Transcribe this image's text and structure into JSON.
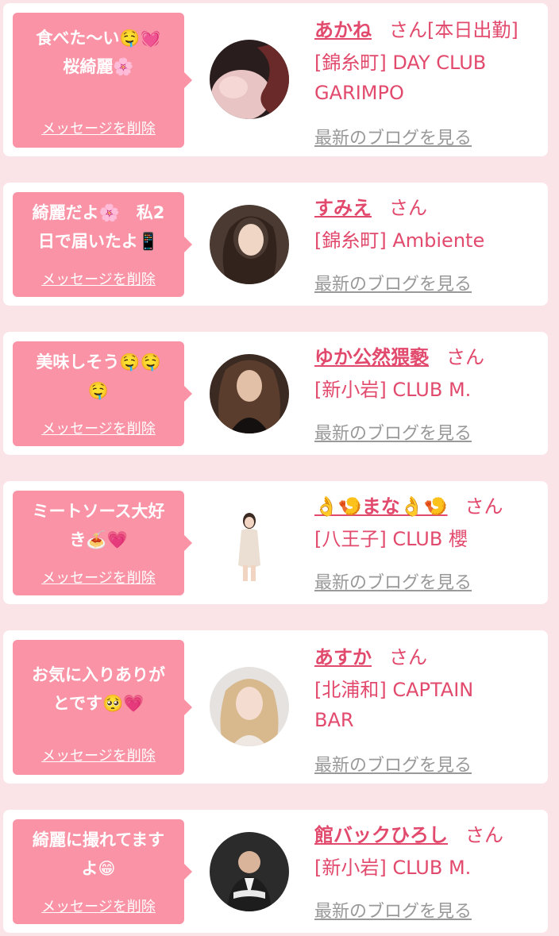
{
  "colors": {
    "page_bg": "#fbe4e8",
    "bubble": "#f993a5",
    "accent": "#e24a6d",
    "link_gray": "#999999"
  },
  "delete_label": "メッセージを削除",
  "blog_label": "最新のブログを見る",
  "suffix": "さん",
  "cards": [
    {
      "message_lines": [
        "食べた〜い🤤💓",
        "桜綺麗🌸"
      ],
      "name": "あかね",
      "status": "[本日出勤]",
      "shop_lines": [
        "[錦糸町] DAY CLUB",
        "GARIMPO"
      ]
    },
    {
      "message_lines": [
        "綺麗だよ🌸　私2",
        "日で届いたよ📱"
      ],
      "name": "すみえ",
      "status": "",
      "shop_lines": [
        "[錦糸町] Ambiente"
      ]
    },
    {
      "message_lines": [
        "美味しそう🤤🤤",
        "🤤"
      ],
      "name": "ゆか公然猥褻",
      "status": "",
      "shop_lines": [
        "[新小岩] CLUB M."
      ]
    },
    {
      "message_lines": [
        "ミートソース大好",
        "き🍝💗"
      ],
      "name": "👌🍤まな👌🍤",
      "status": "",
      "shop_lines": [
        "[八王子] CLUB 櫻"
      ]
    },
    {
      "message_lines": [
        "お気に入りありが",
        "とです🥺💗"
      ],
      "name": "あすか",
      "status": "",
      "shop_lines": [
        "[北浦和] CAPTAIN",
        "BAR"
      ]
    },
    {
      "message_lines": [
        "綺麗に撮れてます",
        "よ😁"
      ],
      "name": "館バックひろし",
      "status": "",
      "shop_lines": [
        "[新小岩] CLUB M."
      ]
    }
  ]
}
